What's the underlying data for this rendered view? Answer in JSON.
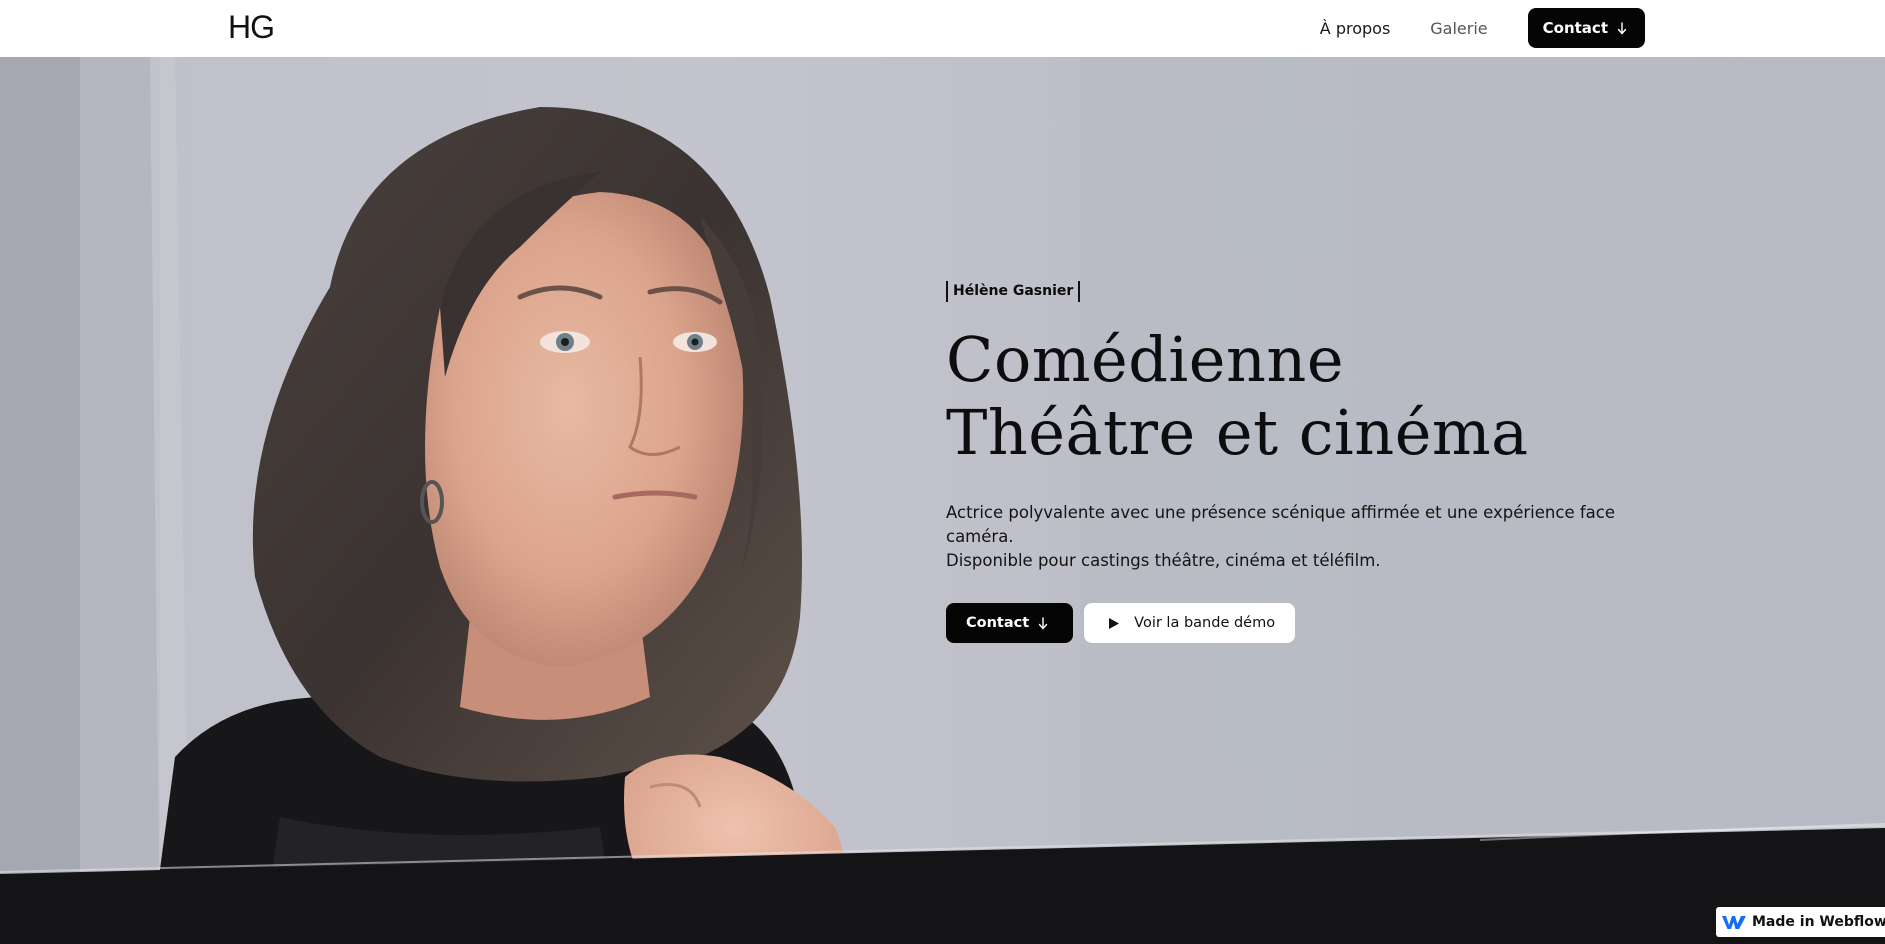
{
  "nav": {
    "logo": "HG",
    "links": [
      {
        "label": "À propos"
      },
      {
        "label": "Galerie"
      }
    ],
    "contact_label": "Contact"
  },
  "hero": {
    "name_tag": "Hélène Gasnier",
    "headline_line1": "Comédienne",
    "headline_line2": "Théâtre et cinéma",
    "desc_line1": "Actrice polyvalente avec une présence scénique affirmée et une expérience face caméra.",
    "desc_line2": "Disponible pour castings théâtre, cinéma et téléfilm.",
    "contact_label": "Contact",
    "demo_label": "Voir la bande démo"
  },
  "badge": {
    "label": "Made in Webflow"
  },
  "colors": {
    "accent": "#050505",
    "hero_bg": "#bfc0ca",
    "footer_bg": "#141316"
  },
  "icons": {
    "contact_arrow": "arrow-down-icon",
    "demo": "play-icon",
    "badge_logo": "webflow-logo-icon"
  }
}
